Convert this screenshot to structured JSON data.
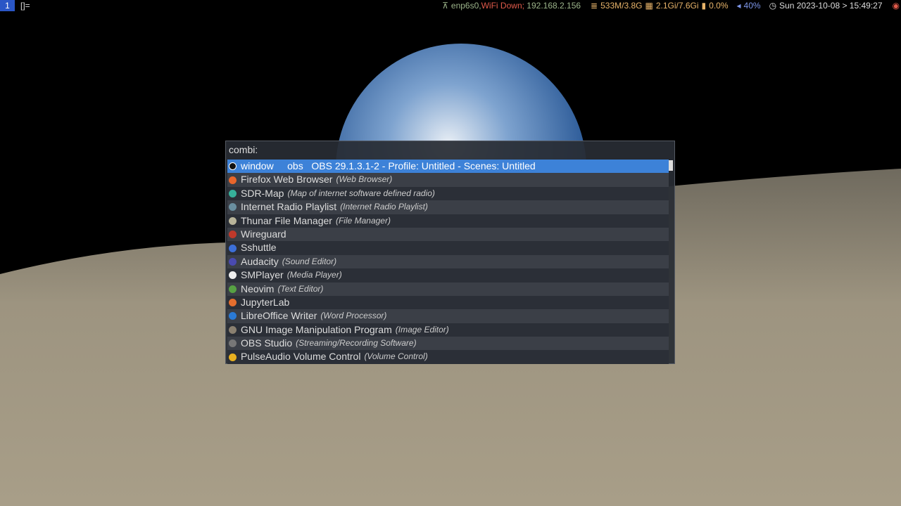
{
  "topbar": {
    "workspace": "1",
    "layout": "[]=",
    "network_iface": "enp6s0,",
    "wifi": "WiFi Down;",
    "ip": "192.168.2.156",
    "memory": "533M/3.8G",
    "swap": "2.1Gi/7.6Gi",
    "cpu": "0.0%",
    "volume": "40%",
    "datetime": "Sun 2023-10-08 > 15:49:27"
  },
  "launcher": {
    "prompt": "combi:",
    "items": [
      {
        "label": "window     obs   OBS 29.1.3.1-2 - Profile: Untitled - Scenes: Untitled",
        "sub": "",
        "color": "#111",
        "selected": true
      },
      {
        "label": "Firefox Web Browser",
        "sub": "(Web Browser)",
        "color": "#e8662c"
      },
      {
        "label": "SDR-Map",
        "sub": "(Map of internet software defined radio)",
        "color": "#36b09a"
      },
      {
        "label": "Internet Radio Playlist",
        "sub": "(Internet Radio Playlist)",
        "color": "#6a8fa0"
      },
      {
        "label": "Thunar File Manager",
        "sub": "(File Manager)",
        "color": "#b8b49a"
      },
      {
        "label": "Wireguard",
        "sub": "",
        "color": "#c0392b"
      },
      {
        "label": "Sshuttle",
        "sub": "",
        "color": "#3c6fd8"
      },
      {
        "label": "Audacity",
        "sub": "(Sound Editor)",
        "color": "#4a4ab0"
      },
      {
        "label": "SMPlayer",
        "sub": "(Media Player)",
        "color": "#eeeeee"
      },
      {
        "label": "Neovim",
        "sub": "(Text Editor)",
        "color": "#57a143"
      },
      {
        "label": "JupyterLab",
        "sub": "",
        "color": "#e46e2e"
      },
      {
        "label": "LibreOffice Writer",
        "sub": "(Word Processor)",
        "color": "#2a7ad6"
      },
      {
        "label": "GNU Image Manipulation Program",
        "sub": "(Image Editor)",
        "color": "#8a8070"
      },
      {
        "label": "OBS Studio",
        "sub": "(Streaming/Recording Software)",
        "color": "#777"
      },
      {
        "label": "PulseAudio Volume Control",
        "sub": "(Volume Control)",
        "color": "#e8b020"
      }
    ]
  }
}
